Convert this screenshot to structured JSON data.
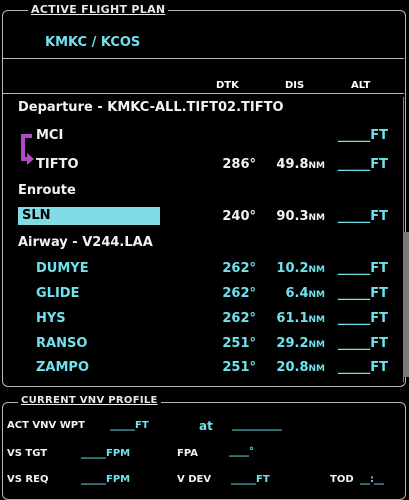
{
  "active_flight_plan": {
    "title": "ACTIVE FLIGHT PLAN",
    "route": "KMKC / KCOS",
    "headers": {
      "dtk": "DTK",
      "dis": "DIS",
      "alt": "ALT"
    },
    "departure_label": "Departure - KMKC-ALL.TIFT02.TIFTO",
    "rows": [
      {
        "wpt": "MCI",
        "dtk": "",
        "dis": "",
        "unit": "",
        "alt": "_____FT"
      },
      {
        "wpt": "TIFTO",
        "dtk": "286°",
        "dis": "49.8",
        "unit": "NM",
        "alt": "_____FT"
      }
    ],
    "enroute_label": "Enroute",
    "enroute_rows": [
      {
        "wpt": "SLN",
        "dtk": "240°",
        "dis": "90.3",
        "unit": "NM",
        "alt": "_____FT"
      }
    ],
    "airway_label": "Airway - V244.LAA",
    "airway_rows": [
      {
        "wpt": "DUMYE",
        "dtk": "262°",
        "dis": "10.2",
        "unit": "NM",
        "alt": "_____FT"
      },
      {
        "wpt": "GLIDE",
        "dtk": "262°",
        "dis": "6.4",
        "unit": "NM",
        "alt": "_____FT"
      },
      {
        "wpt": "HYS",
        "dtk": "262°",
        "dis": "61.1",
        "unit": "NM",
        "alt": "_____FT"
      },
      {
        "wpt": "RANSO",
        "dtk": "251°",
        "dis": "29.2",
        "unit": "NM",
        "alt": "_____FT"
      },
      {
        "wpt": "ZAMPO",
        "dtk": "251°",
        "dis": "20.8",
        "unit": "NM",
        "alt": "_____FT"
      }
    ]
  },
  "vnv_profile": {
    "title": "CURRENT VNV PROFILE",
    "act_vnv_wpt_label": "ACT VNV WPT",
    "act_vnv_wpt_value": "_____FT",
    "at_label": "at",
    "at_value": "__________",
    "vs_tgt_label": "VS TGT",
    "vs_tgt_value": "_____FPM",
    "fpa_label": "FPA",
    "fpa_value": "____°",
    "vs_req_label": "VS REQ",
    "vs_req_value": "_____FPM",
    "v_dev_label": "V DEV",
    "v_dev_value": "_____FT",
    "tod_label": "TOD",
    "tod_value": "__:__"
  }
}
